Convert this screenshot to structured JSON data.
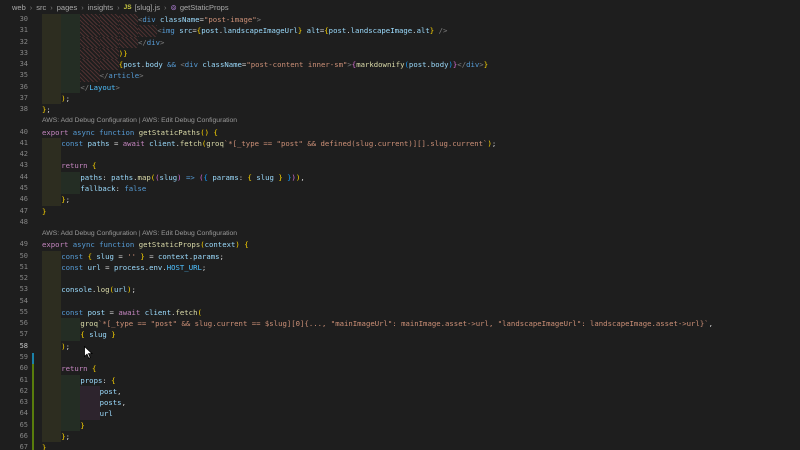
{
  "breadcrumb": {
    "items": [
      "web",
      "src",
      "pages",
      "insights",
      "[slug].js",
      "getStaticProps"
    ],
    "file_badge": "JS"
  },
  "editor": {
    "codelens": "AWS: Add Debug Configuration | AWS: Edit Debug Configuration",
    "active_line": 58,
    "lines": [
      {
        "n": 30,
        "t": "<div className=\"post-image\">"
      },
      {
        "n": 31,
        "t": "<img src={post.landscapeImageUrl} alt={post.landscapeImage.alt} />"
      },
      {
        "n": 32,
        "t": "</div>"
      },
      {
        "n": 33,
        "t": ")}"
      },
      {
        "n": 34,
        "t": "{post.body && <div className=\"post-content inner-sm\">{markdownify(post.body)}</div>}"
      },
      {
        "n": 35,
        "t": "</article>"
      },
      {
        "n": 36,
        "t": "</Layout>"
      },
      {
        "n": 37,
        "t": ");"
      },
      {
        "n": 38,
        "t": "};"
      },
      {
        "n": 40,
        "t": "export async function getStaticPaths() {"
      },
      {
        "n": 41,
        "t": "const paths = await client.fetch(groq`*[_type == \"post\" && defined(slug.current)][].slug.current`);"
      },
      {
        "n": 42,
        "t": ""
      },
      {
        "n": 43,
        "t": "return {"
      },
      {
        "n": 44,
        "t": "paths: paths.map((slug) => ({ params: { slug } })),"
      },
      {
        "n": 45,
        "t": "fallback: false"
      },
      {
        "n": 46,
        "t": "};"
      },
      {
        "n": 47,
        "t": "}"
      },
      {
        "n": 48,
        "t": ""
      },
      {
        "n": 49,
        "t": "export async function getStaticProps(context) {"
      },
      {
        "n": 50,
        "t": "const { slug = '' } = context.params;"
      },
      {
        "n": 51,
        "t": "const url = process.env.HOST_URL;"
      },
      {
        "n": 52,
        "t": ""
      },
      {
        "n": 53,
        "t": "console.log(url);"
      },
      {
        "n": 54,
        "t": ""
      },
      {
        "n": 55,
        "t": "const post = await client.fetch("
      },
      {
        "n": 56,
        "t": "groq`*[_type == \"post\" && slug.current == $slug][0]{..., \"mainImageUrl\": mainImage.asset->url, \"landscapeImageUrl\": landscapeImage.asset->url}`,"
      },
      {
        "n": 57,
        "t": "{ slug }"
      },
      {
        "n": 58,
        "t": ");"
      },
      {
        "n": 59,
        "t": ""
      },
      {
        "n": 60,
        "t": "return {"
      },
      {
        "n": 61,
        "t": "props: {"
      },
      {
        "n": 62,
        "t": "post,"
      },
      {
        "n": 63,
        "t": "posts,"
      },
      {
        "n": 64,
        "t": "url"
      },
      {
        "n": 65,
        "t": "}"
      },
      {
        "n": 66,
        "t": "};"
      },
      {
        "n": 67,
        "t": "}"
      }
    ]
  },
  "colors": {
    "background": "#1e1e1e",
    "keyword": "#569cd6",
    "control": "#c586c0",
    "function": "#dcdcaa",
    "variable": "#9cdcfe",
    "string": "#ce9178",
    "gutter_added": "#587c0c"
  }
}
